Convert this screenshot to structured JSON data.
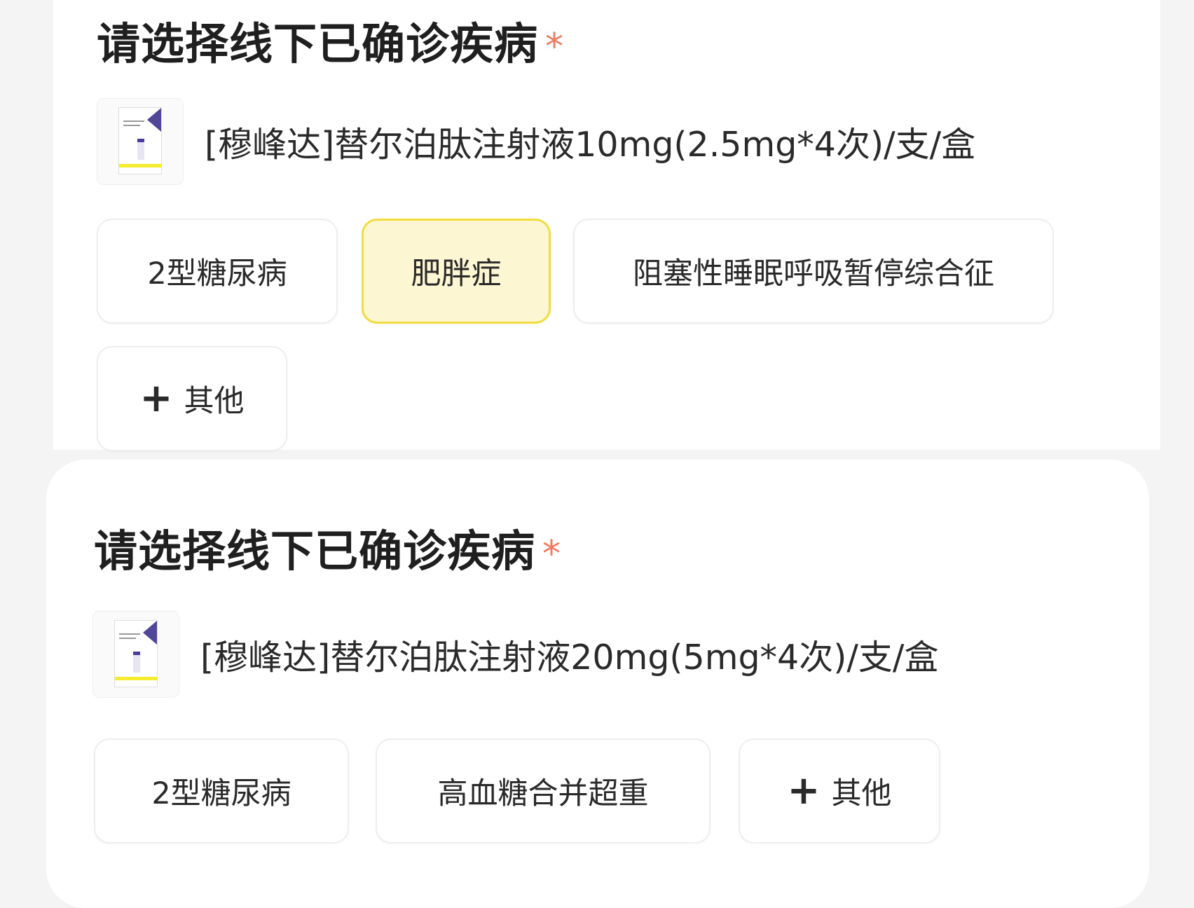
{
  "sections": [
    {
      "title": "请选择线下已确诊疾病",
      "required_mark": "*",
      "product_name": "[穆峰达]替尔泊肽注射液10mg(2.5mg*4次)/支/盒",
      "options": [
        {
          "label": "2型糖尿病",
          "selected": false
        },
        {
          "label": "肥胖症",
          "selected": true
        },
        {
          "label": "阻塞性睡眠呼吸暂停综合征",
          "selected": false
        }
      ],
      "other": {
        "icon": "plus-icon",
        "plus": "+",
        "label": "其他"
      }
    },
    {
      "title": "请选择线下已确诊疾病",
      "required_mark": "*",
      "product_name": "[穆峰达]替尔泊肽注射液20mg(5mg*4次)/支/盒",
      "options": [
        {
          "label": "2型糖尿病",
          "selected": false
        },
        {
          "label": "高血糖合并超重",
          "selected": false
        }
      ],
      "other": {
        "icon": "plus-icon",
        "plus": "+",
        "label": "其他"
      }
    }
  ],
  "colors": {
    "selected_background": "#fdf6d2",
    "selected_border": "#f2dd3e",
    "required_star": "#f07a5e"
  }
}
